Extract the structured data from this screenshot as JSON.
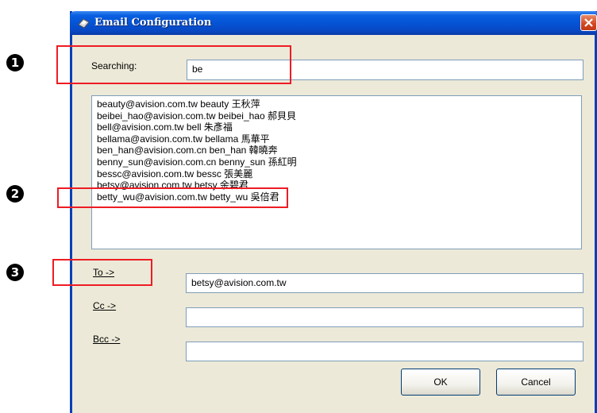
{
  "window": {
    "title": "Email Configuration"
  },
  "search": {
    "label": "Searching:",
    "value": "be"
  },
  "contacts": [
    "beauty@avision.com.tw beauty 王秋萍",
    "beibei_hao@avision.com.tw beibei_hao 郝貝貝",
    "bell@avision.com.tw bell 朱彥福",
    "bellama@avision.com.tw bellama 馬華平",
    "ben_han@avision.com.cn ben_han 韓曉奔",
    "benny_sun@avision.com.cn benny_sun 孫紅明",
    "bessc@avision.com.tw bessc 張美麗",
    "betsy@avision.com.tw betsy 余碧君",
    "betty_wu@avision.com.tw betty_wu 吳倍君"
  ],
  "recipients": {
    "to_label": "To ->",
    "to_value": "betsy@avision.com.tw",
    "cc_label": "Cc ->",
    "cc_value": "",
    "bcc_label": "Bcc ->",
    "bcc_value": ""
  },
  "buttons": {
    "ok": "OK",
    "cancel": "Cancel"
  },
  "callouts": [
    "1",
    "2",
    "3"
  ],
  "colors": {
    "titlebar": "#0554d6",
    "dialog_bg": "#ece9d8",
    "annotation": "#ee1c24",
    "close_button": "#d4451f"
  }
}
